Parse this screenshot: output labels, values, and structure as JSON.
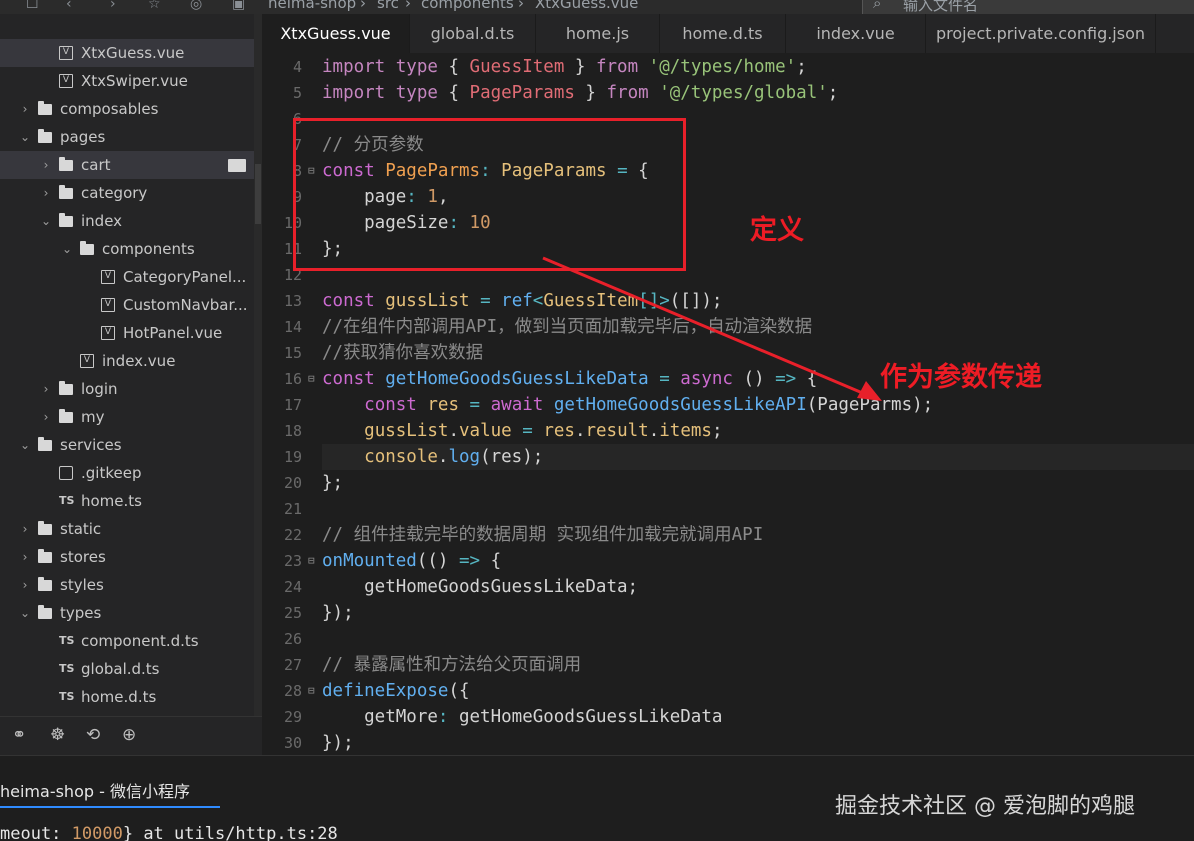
{
  "topbar": {
    "crumbs": [
      "heima-shop",
      "src",
      "components",
      "XtxGuess.vue"
    ],
    "search_placeholder": "输入文件名"
  },
  "sidebar": {
    "items": [
      {
        "label": "XtxGuess.vue",
        "type": "vue",
        "depth": 2,
        "expanded": null,
        "active": true
      },
      {
        "label": "XtxSwiper.vue",
        "type": "vue",
        "depth": 2,
        "expanded": null,
        "active": false
      },
      {
        "label": "composables",
        "type": "folder",
        "depth": 1,
        "expanded": false,
        "active": false
      },
      {
        "label": "pages",
        "type": "folder",
        "depth": 1,
        "expanded": true,
        "active": false
      },
      {
        "label": "cart",
        "type": "folder",
        "depth": 2,
        "expanded": false,
        "active": true
      },
      {
        "label": "category",
        "type": "folder",
        "depth": 2,
        "expanded": false,
        "active": false
      },
      {
        "label": "index",
        "type": "folder",
        "depth": 2,
        "expanded": true,
        "active": false
      },
      {
        "label": "components",
        "type": "folder",
        "depth": 3,
        "expanded": true,
        "active": false
      },
      {
        "label": "CategoryPanel...",
        "type": "vue",
        "depth": 4,
        "expanded": null,
        "active": false
      },
      {
        "label": "CustomNavbar...",
        "type": "vue",
        "depth": 4,
        "expanded": null,
        "active": false
      },
      {
        "label": "HotPanel.vue",
        "type": "vue",
        "depth": 4,
        "expanded": null,
        "active": false
      },
      {
        "label": "index.vue",
        "type": "vue",
        "depth": 3,
        "expanded": null,
        "active": false
      },
      {
        "label": "login",
        "type": "folder",
        "depth": 2,
        "expanded": false,
        "active": false
      },
      {
        "label": "my",
        "type": "folder",
        "depth": 2,
        "expanded": false,
        "active": false
      },
      {
        "label": "services",
        "type": "folder",
        "depth": 1,
        "expanded": true,
        "active": false
      },
      {
        "label": ".gitkeep",
        "type": "file",
        "depth": 2,
        "expanded": null,
        "active": false
      },
      {
        "label": "home.ts",
        "type": "ts",
        "depth": 2,
        "expanded": null,
        "active": false
      },
      {
        "label": "static",
        "type": "folder",
        "depth": 1,
        "expanded": false,
        "active": false
      },
      {
        "label": "stores",
        "type": "folder",
        "depth": 1,
        "expanded": false,
        "active": false
      },
      {
        "label": "styles",
        "type": "folder",
        "depth": 1,
        "expanded": false,
        "active": false
      },
      {
        "label": "types",
        "type": "folder",
        "depth": 1,
        "expanded": true,
        "active": false
      },
      {
        "label": "component.d.ts",
        "type": "ts",
        "depth": 2,
        "expanded": null,
        "active": false
      },
      {
        "label": "global.d.ts",
        "type": "ts",
        "depth": 2,
        "expanded": null,
        "active": false
      },
      {
        "label": "home.d.ts",
        "type": "ts",
        "depth": 2,
        "expanded": null,
        "active": false
      }
    ],
    "tools": [
      "binoculars-icon",
      "bug-icon",
      "source-control-icon",
      "extensions-icon"
    ]
  },
  "tabs": [
    {
      "label": "XtxGuess.vue",
      "active": true
    },
    {
      "label": "global.d.ts",
      "active": false
    },
    {
      "label": "home.js",
      "active": false
    },
    {
      "label": "home.d.ts",
      "active": false
    },
    {
      "label": "index.vue",
      "active": false
    },
    {
      "label": "project.private.config.json",
      "active": false
    }
  ],
  "code_lines": [
    {
      "n": "4",
      "fold": "",
      "current": false,
      "tokens": [
        [
          "kw",
          "import"
        ],
        [
          "pl",
          " "
        ],
        [
          "kw",
          "type"
        ],
        [
          "pl",
          " { "
        ],
        [
          "vr",
          "GuessItem"
        ],
        [
          "pl",
          " } "
        ],
        [
          "kw",
          "from"
        ],
        [
          "pl",
          " "
        ],
        [
          "str",
          "'@/types/home'"
        ],
        [
          "pl",
          ";"
        ]
      ]
    },
    {
      "n": "5",
      "fold": "",
      "current": false,
      "tokens": [
        [
          "kw",
          "import"
        ],
        [
          "pl",
          " "
        ],
        [
          "kw",
          "type"
        ],
        [
          "pl",
          " { "
        ],
        [
          "vr",
          "PageParams"
        ],
        [
          "pl",
          " } "
        ],
        [
          "kw",
          "from"
        ],
        [
          "pl",
          " "
        ],
        [
          "str",
          "'@/types/global'"
        ],
        [
          "pl",
          ";"
        ]
      ]
    },
    {
      "n": "6",
      "fold": "",
      "current": false,
      "tokens": []
    },
    {
      "n": "7",
      "fold": "",
      "current": false,
      "tokens": [
        [
          "cm",
          "// 分页参数"
        ]
      ]
    },
    {
      "n": "8",
      "fold": "⊟",
      "current": false,
      "tokens": [
        [
          "kw2",
          "const"
        ],
        [
          "pl",
          " "
        ],
        [
          "ty2",
          "PageParms"
        ],
        [
          "op",
          ":"
        ],
        [
          "pl",
          " "
        ],
        [
          "ty",
          "PageParams"
        ],
        [
          "pl",
          " "
        ],
        [
          "op",
          "="
        ],
        [
          "pl",
          " {"
        ]
      ]
    },
    {
      "n": "9",
      "fold": "",
      "current": false,
      "tokens": [
        [
          "pl",
          "    page"
        ],
        [
          "op",
          ":"
        ],
        [
          "pl",
          " "
        ],
        [
          "num",
          "1"
        ],
        [
          "pl",
          ","
        ]
      ]
    },
    {
      "n": "10",
      "fold": "",
      "current": false,
      "tokens": [
        [
          "pl",
          "    pageSize"
        ],
        [
          "op",
          ":"
        ],
        [
          "pl",
          " "
        ],
        [
          "num",
          "10"
        ]
      ]
    },
    {
      "n": "11",
      "fold": "",
      "current": false,
      "tokens": [
        [
          "pl",
          "};"
        ]
      ]
    },
    {
      "n": "12",
      "fold": "",
      "current": false,
      "tokens": []
    },
    {
      "n": "13",
      "fold": "",
      "current": false,
      "tokens": [
        [
          "kw2",
          "const"
        ],
        [
          "pl",
          " "
        ],
        [
          "ty",
          "gussList"
        ],
        [
          "pl",
          " "
        ],
        [
          "op",
          "="
        ],
        [
          "pl",
          " "
        ],
        [
          "fn",
          "ref"
        ],
        [
          "op",
          "<"
        ],
        [
          "ty",
          "GuessItem"
        ],
        [
          "op",
          "[]>"
        ],
        [
          "pl",
          "([]);"
        ]
      ]
    },
    {
      "n": "14",
      "fold": "",
      "current": false,
      "tokens": [
        [
          "cm",
          "//在组件内部调用API，做到当页面加载完毕后，自动渲染数据"
        ]
      ]
    },
    {
      "n": "15",
      "fold": "",
      "current": false,
      "tokens": [
        [
          "cm",
          "//获取猜你喜欢数据"
        ]
      ]
    },
    {
      "n": "16",
      "fold": "⊟",
      "current": false,
      "tokens": [
        [
          "kw2",
          "const"
        ],
        [
          "pl",
          " "
        ],
        [
          "fn",
          "getHomeGoodsGuessLikeData"
        ],
        [
          "pl",
          " "
        ],
        [
          "op",
          "="
        ],
        [
          "pl",
          " "
        ],
        [
          "kw2",
          "async"
        ],
        [
          "pl",
          " () "
        ],
        [
          "op",
          "=>"
        ],
        [
          "pl",
          " {"
        ]
      ]
    },
    {
      "n": "17",
      "fold": "",
      "current": false,
      "tokens": [
        [
          "pl",
          "    "
        ],
        [
          "kw2",
          "const"
        ],
        [
          "pl",
          " "
        ],
        [
          "ty",
          "res"
        ],
        [
          "pl",
          " "
        ],
        [
          "op",
          "="
        ],
        [
          "pl",
          " "
        ],
        [
          "kw2",
          "await"
        ],
        [
          "pl",
          " "
        ],
        [
          "fn",
          "getHomeGoodsGuessLikeAPI"
        ],
        [
          "pl",
          "(PageParms);"
        ]
      ]
    },
    {
      "n": "18",
      "fold": "",
      "current": false,
      "tokens": [
        [
          "pl",
          "    "
        ],
        [
          "ty",
          "gussList"
        ],
        [
          "pl",
          "."
        ],
        [
          "ty",
          "value"
        ],
        [
          "pl",
          " "
        ],
        [
          "op",
          "="
        ],
        [
          "pl",
          " "
        ],
        [
          "ty",
          "res"
        ],
        [
          "pl",
          "."
        ],
        [
          "ty",
          "result"
        ],
        [
          "pl",
          "."
        ],
        [
          "ty",
          "items"
        ],
        [
          "pl",
          ";"
        ]
      ]
    },
    {
      "n": "19",
      "fold": "",
      "current": true,
      "tokens": [
        [
          "pl",
          "    "
        ],
        [
          "ty",
          "console"
        ],
        [
          "pl",
          "."
        ],
        [
          "fn",
          "log"
        ],
        [
          "pl",
          "(res);"
        ]
      ]
    },
    {
      "n": "20",
      "fold": "",
      "current": false,
      "tokens": [
        [
          "pl",
          "};"
        ]
      ]
    },
    {
      "n": "21",
      "fold": "",
      "current": false,
      "tokens": []
    },
    {
      "n": "22",
      "fold": "",
      "current": false,
      "tokens": [
        [
          "cm",
          "// 组件挂载完毕的数据周期 实现组件加载完就调用API"
        ]
      ]
    },
    {
      "n": "23",
      "fold": "⊟",
      "current": false,
      "tokens": [
        [
          "fn",
          "onMounted"
        ],
        [
          "pl",
          "(() "
        ],
        [
          "op",
          "=>"
        ],
        [
          "pl",
          " {"
        ]
      ]
    },
    {
      "n": "24",
      "fold": "",
      "current": false,
      "tokens": [
        [
          "pl",
          "    getHomeGoodsGuessLikeData;"
        ]
      ]
    },
    {
      "n": "25",
      "fold": "",
      "current": false,
      "tokens": [
        [
          "pl",
          "});"
        ]
      ]
    },
    {
      "n": "26",
      "fold": "",
      "current": false,
      "tokens": []
    },
    {
      "n": "27",
      "fold": "",
      "current": false,
      "tokens": [
        [
          "cm",
          "// 暴露属性和方法给父页面调用"
        ]
      ]
    },
    {
      "n": "28",
      "fold": "⊟",
      "current": false,
      "tokens": [
        [
          "fn",
          "defineExpose"
        ],
        [
          "pl",
          "({"
        ]
      ]
    },
    {
      "n": "29",
      "fold": "",
      "current": false,
      "tokens": [
        [
          "pl",
          "    getMore"
        ],
        [
          "op",
          ":"
        ],
        [
          "pl",
          " getHomeGoodsGuessLikeData"
        ]
      ]
    },
    {
      "n": "30",
      "fold": "",
      "current": false,
      "tokens": [
        [
          "pl",
          "});"
        ]
      ]
    }
  ],
  "annotations": {
    "define_label": "定义",
    "pass_label": "作为参数传递",
    "color": "#e8202a"
  },
  "bottom_panel": {
    "tab_label": "heima-shop - 微信小程序",
    "console_line_parts": [
      "meout: ",
      "10000",
      "} at utils/http.ts:28"
    ]
  },
  "watermark": "掘金技术社区 @ 爱泡脚的鸡腿",
  "colors": {
    "keyword": "#c586c0",
    "string": "#98c379",
    "function": "#61afef",
    "number": "#d19a66",
    "comment": "#8a8a8a",
    "accent": "#2f8bff"
  }
}
